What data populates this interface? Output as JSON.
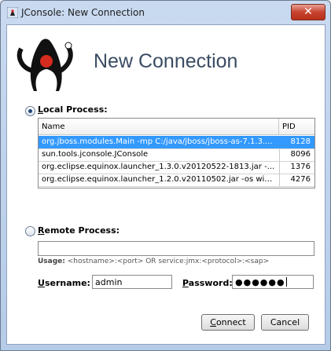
{
  "window": {
    "title": "JConsole: New Connection",
    "close_glyph": "✕"
  },
  "banner": {
    "title": "New Connection",
    "logo_icon": "duke-mascot-icon"
  },
  "local": {
    "label_first": "L",
    "label_rest": "ocal Process:",
    "selected": true,
    "columns": {
      "name": "Name",
      "pid": "PID"
    },
    "rows": [
      {
        "name": "org.jboss.modules.Main -mp C:/java/jboss/jboss-as-7.1.3....",
        "pid": "8128"
      },
      {
        "name": "sun.tools.jconsole.JConsole",
        "pid": "8096"
      },
      {
        "name": "org.eclipse.equinox.launcher_1.3.0.v20120522-1813.jar -...",
        "pid": "1376"
      },
      {
        "name": "org.eclipse.equinox.launcher_1.2.0.v20110502.jar -os win...",
        "pid": "4276"
      }
    ],
    "selected_row": 0
  },
  "remote": {
    "label_first": "R",
    "label_rest": "emote Process:",
    "selected": false,
    "value": "",
    "usage_label": "Usage:",
    "usage_text": "<hostname>:<port> OR service:jmx:<protocol>:<sap>"
  },
  "credentials": {
    "username_label_first": "U",
    "username_label_rest": "sername:",
    "username_value": "admin",
    "password_label_first": "P",
    "password_label_rest": "assword:",
    "password_mask": "●●●●●●"
  },
  "buttons": {
    "connect_first": "C",
    "connect_rest": "onnect",
    "cancel": "Cancel"
  },
  "colors": {
    "selection": "#3399ff",
    "title_text": "#3a4c63"
  }
}
